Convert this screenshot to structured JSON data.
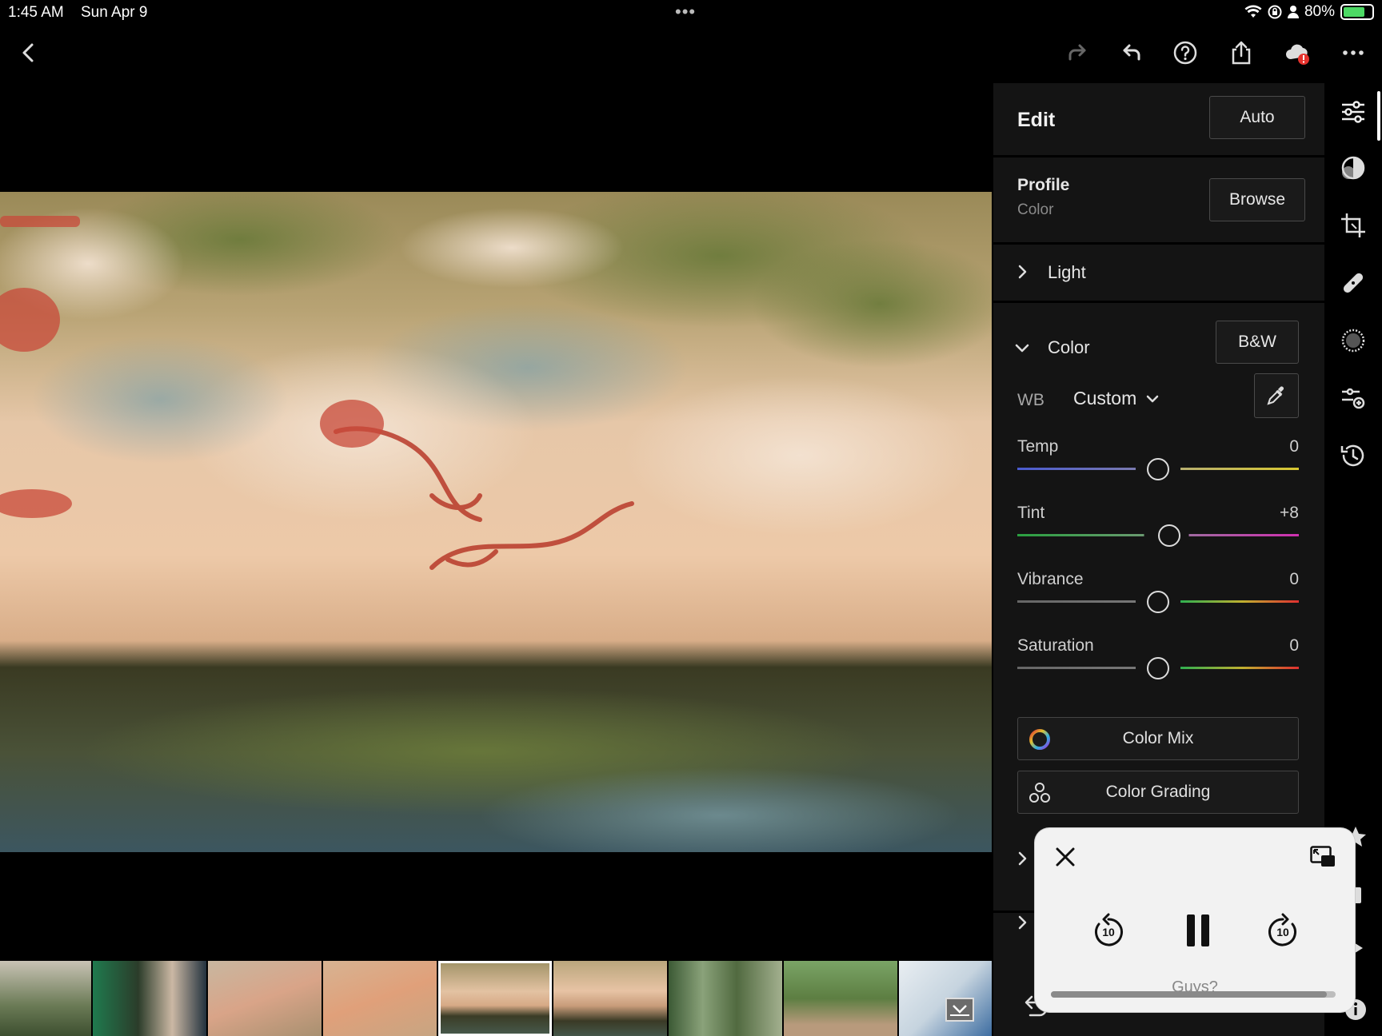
{
  "status": {
    "time": "1:45 AM",
    "date": "Sun Apr 9",
    "battery_text": "80%",
    "battery_level": 0.8
  },
  "toolbar": {
    "icons": [
      "back-icon",
      "redo-icon",
      "undo-icon",
      "help-icon",
      "share-icon",
      "cloud-alert-icon",
      "more-icon"
    ]
  },
  "edit": {
    "title": "Edit",
    "auto_label": "Auto",
    "profile_label": "Profile",
    "profile_value": "Color",
    "browse_label": "Browse",
    "light_label": "Light",
    "color_label": "Color",
    "bw_label": "B&W",
    "wb_label": "WB",
    "wb_value": "Custom",
    "sliders": [
      {
        "name": "Temp",
        "value": "0",
        "position": 0.5
      },
      {
        "name": "Tint",
        "value": "+8",
        "position": 0.54
      },
      {
        "name": "Vibrance",
        "value": "0",
        "position": 0.5
      },
      {
        "name": "Saturation",
        "value": "0",
        "position": 0.5
      }
    ],
    "color_mix_label": "Color Mix",
    "color_grading_label": "Color Grading"
  },
  "rail": {
    "icons": [
      "edit-sliders-icon",
      "masking-icon",
      "crop-icon",
      "healing-icon",
      "vignette-icon",
      "presets-icon",
      "history-icon",
      "star-icon",
      "info-icon"
    ]
  },
  "video": {
    "subtitle": "Guys?",
    "skip_seconds": "10",
    "progress": 0.97
  },
  "colors": {
    "panel_bg": "#141414",
    "accent_green": "#4cd964",
    "alert_red": "#e5322d"
  }
}
